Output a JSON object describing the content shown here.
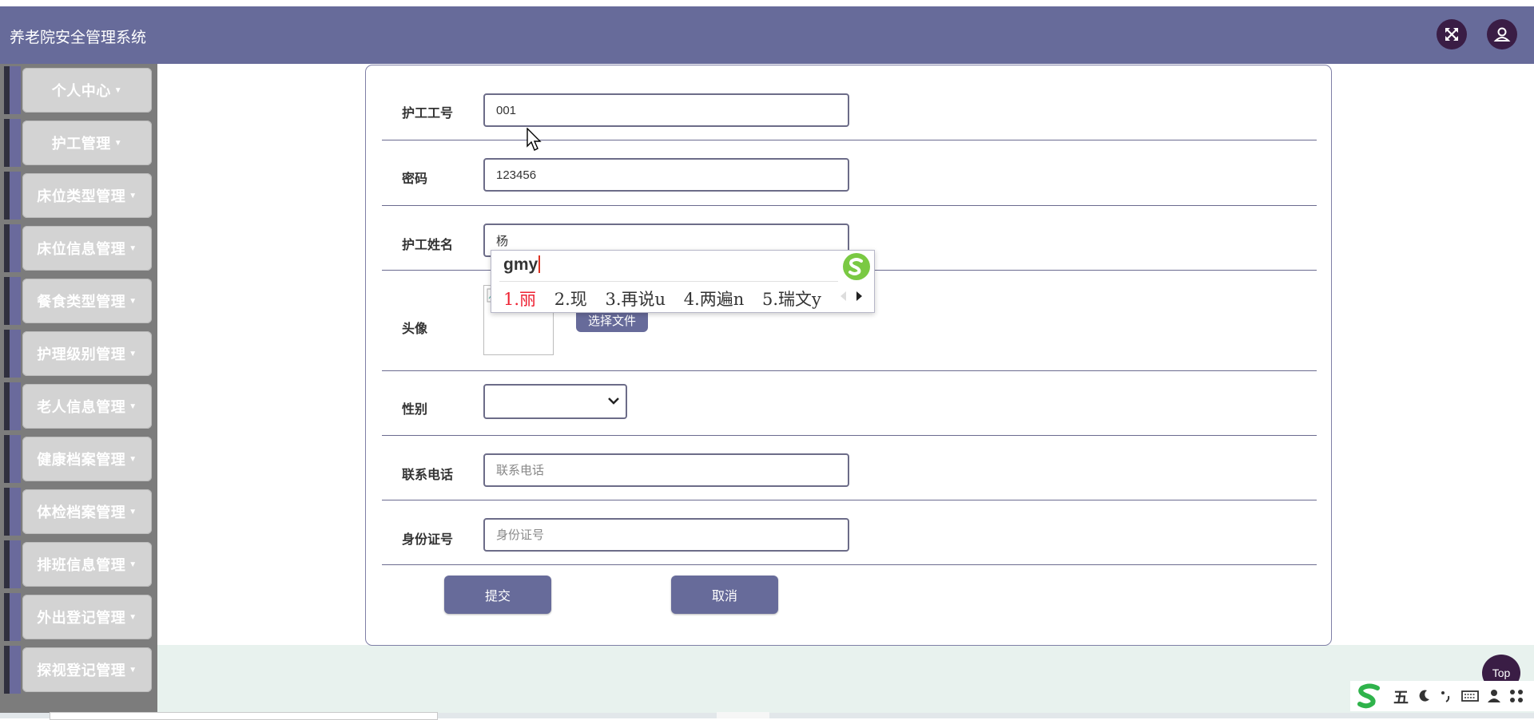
{
  "app": {
    "title": "养老院安全管理系统"
  },
  "header": {
    "fullscreen_icon": "expand-icon",
    "user_icon": "user-icon"
  },
  "sidebar": {
    "items": [
      {
        "label": "个人中心"
      },
      {
        "label": "护工管理"
      },
      {
        "label": "床位类型管理"
      },
      {
        "label": "床位信息管理"
      },
      {
        "label": "餐食类型管理"
      },
      {
        "label": "护理级别管理"
      },
      {
        "label": "老人信息管理"
      },
      {
        "label": "健康档案管理"
      },
      {
        "label": "体检档案管理"
      },
      {
        "label": "排班信息管理"
      },
      {
        "label": "外出登记管理"
      },
      {
        "label": "探视登记管理"
      }
    ]
  },
  "form": {
    "fields": {
      "worker_id": {
        "label": "护工工号",
        "value": "001"
      },
      "password": {
        "label": "密码",
        "value": "123456"
      },
      "name": {
        "label": "护工姓名",
        "value": "杨"
      },
      "avatar": {
        "label": "头像",
        "button": "选择文件"
      },
      "gender": {
        "label": "性别",
        "value": ""
      },
      "phone": {
        "label": "联系电话",
        "placeholder": "联系电话"
      },
      "id_card": {
        "label": "身份证号",
        "placeholder": "身份证号"
      }
    },
    "submit_label": "提交",
    "cancel_label": "取消"
  },
  "ime": {
    "input": "gmy",
    "candidates": [
      "1.丽",
      "2.现",
      "3.再说u",
      "4.两遍n",
      "5.瑞文y"
    ]
  },
  "top_button": "Top",
  "ime_toolbar": {
    "mode_label": "五"
  },
  "colors": {
    "header": "#676b9a",
    "accent_dark": "#3a1d45",
    "sidebar_bg": "#7c7c7c"
  }
}
